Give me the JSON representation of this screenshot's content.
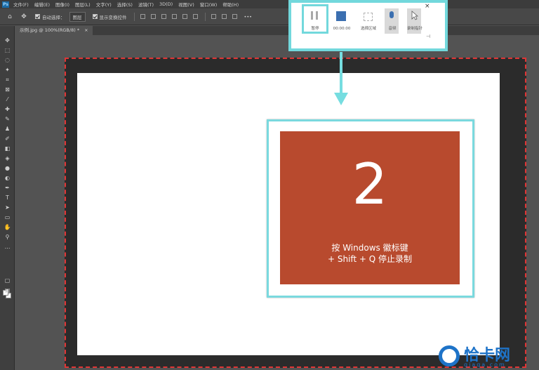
{
  "menu": {
    "items": [
      "文件(F)",
      "编辑(E)",
      "图像(I)",
      "图层(L)",
      "文字(Y)",
      "选择(S)",
      "滤镜(T)",
      "3D(D)",
      "视图(V)",
      "窗口(W)",
      "帮助(H)"
    ]
  },
  "options": {
    "auto_select_label": "自动选择：",
    "auto_select_value": "图层",
    "show_transform_label": "显示变换控件",
    "more": "•••"
  },
  "document": {
    "tab_title": "示例.jpg @ 100%(RGB/8) *",
    "tab_close": "×"
  },
  "recorder": {
    "pause_label": "暂停",
    "stop_time": "00:00:00",
    "region_label": "选择区域",
    "audio_label": "音频",
    "pointer_label": "录制指针",
    "close": "×",
    "pin": "⊣"
  },
  "slide": {
    "countdown": "2",
    "hint_line1": "按 Windows 徽标键",
    "hint_line2": "+ Shift + Q 停止录制",
    "color": "#b84a2e"
  },
  "watermark": {
    "title": "恰卡网",
    "url": "qiaqa.com",
    "color": "#1e73c8"
  },
  "accent": "#72d8dc"
}
